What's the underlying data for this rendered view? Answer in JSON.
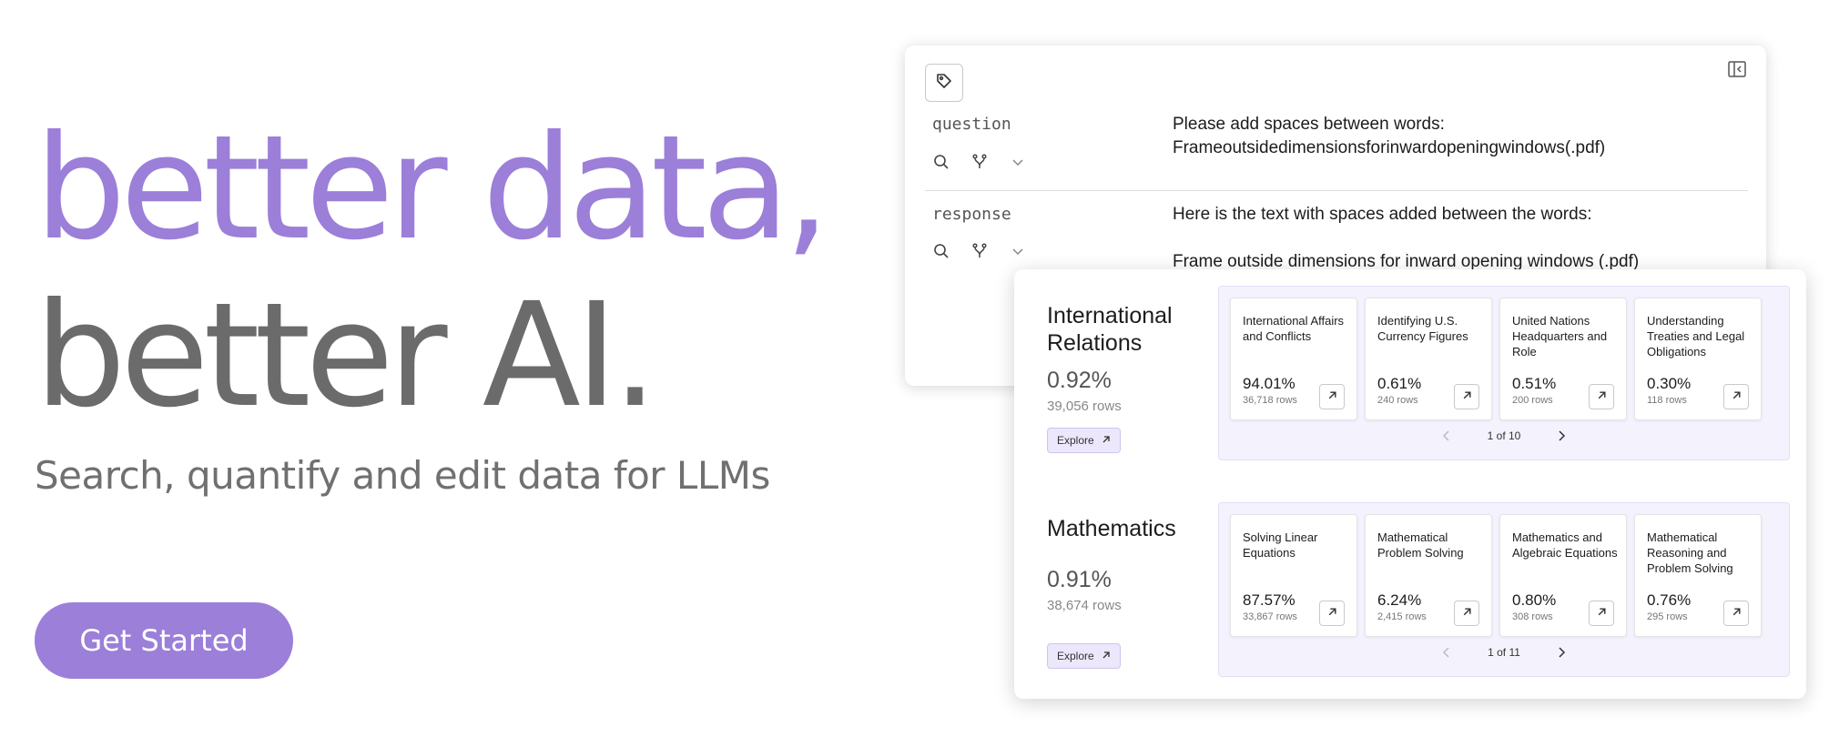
{
  "hero": {
    "line1": "better data,",
    "line2": "better AI.",
    "subtitle": "Search, quantify and edit data for LLMs",
    "cta_label": "Get Started"
  },
  "colors": {
    "accent": "#9b7fd9",
    "hero_gray": "#6b6b6b",
    "panel_bg": "#f4f2fd"
  },
  "record": {
    "fields": [
      {
        "key": "question",
        "value_lines": [
          "Please add spaces between words:",
          "Frameoutsidedimensionsforinwardopeningwindows(.pdf)"
        ]
      },
      {
        "key": "response",
        "value_lines": [
          "Here is the text with spaces added between the words:",
          "",
          "Frame outside dimensions for inward opening windows (.pdf)"
        ]
      }
    ],
    "icons": [
      "tag-icon",
      "sidebar-collapse-icon",
      "search-icon",
      "fork-icon",
      "chevron-down-icon"
    ]
  },
  "sections": [
    {
      "title": "International Relations",
      "pct": "0.92%",
      "rows": "39,056 rows",
      "explore_label": "Explore",
      "pager": "1 of 10",
      "items": [
        {
          "title": "International Affairs and Conflicts",
          "pct": "94.01%",
          "rows": "36,718 rows"
        },
        {
          "title": "Identifying U.S. Currency Figures",
          "pct": "0.61%",
          "rows": "240 rows"
        },
        {
          "title": "United Nations Headquarters and Role",
          "pct": "0.51%",
          "rows": "200 rows"
        },
        {
          "title": "Understanding Treaties and Legal Obligations",
          "pct": "0.30%",
          "rows": "118 rows"
        }
      ]
    },
    {
      "title": "Mathematics",
      "pct": "0.91%",
      "rows": "38,674 rows",
      "explore_label": "Explore",
      "pager": "1 of 11",
      "items": [
        {
          "title": "Solving Linear Equations",
          "pct": "87.57%",
          "rows": "33,867 rows"
        },
        {
          "title": "Mathematical Problem Solving",
          "pct": "6.24%",
          "rows": "2,415 rows"
        },
        {
          "title": "Mathematics and Algebraic Equations",
          "pct": "0.80%",
          "rows": "308 rows"
        },
        {
          "title": "Mathematical Reasoning and Problem Solving",
          "pct": "0.76%",
          "rows": "295 rows"
        }
      ]
    }
  ]
}
